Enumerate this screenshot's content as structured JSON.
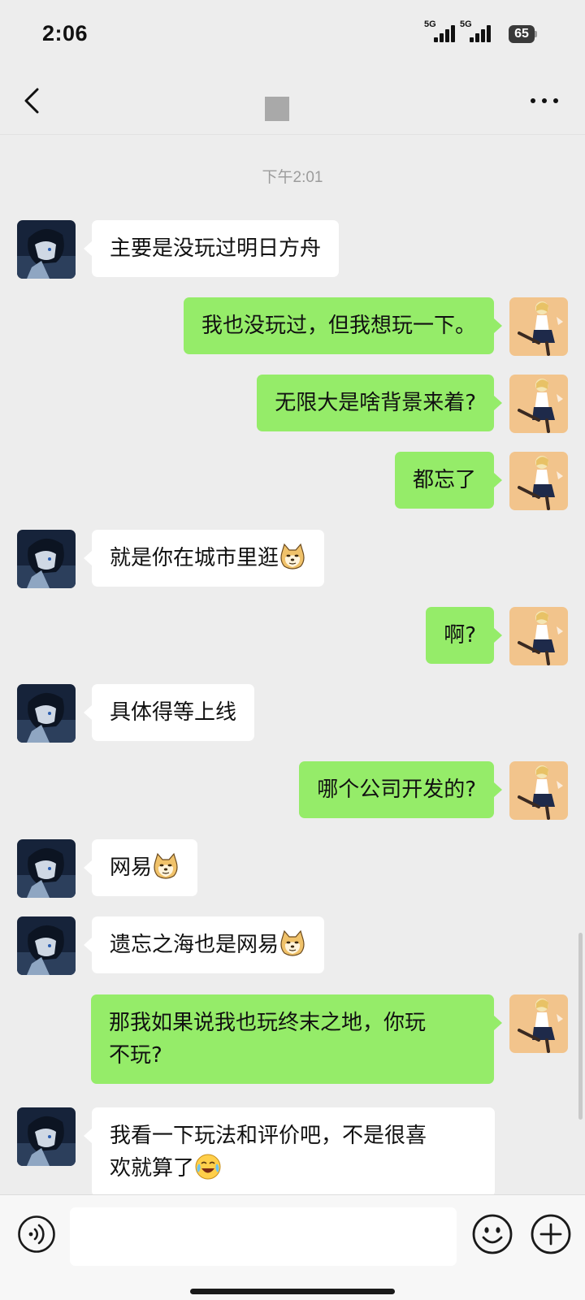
{
  "status_bar": {
    "time": "2:06",
    "sim1": "5G",
    "sim2": "5G",
    "battery": "65"
  },
  "header": {
    "back_icon": "chevron-left-icon",
    "more_icon": "ellipsis-icon"
  },
  "chat": {
    "timestamp": "下午2:01",
    "messages": [
      {
        "side": "left",
        "text": "主要是没玩过明日方舟",
        "emoji": null
      },
      {
        "side": "right",
        "text": "我也没玩过，但我想玩一下。",
        "emoji": null
      },
      {
        "side": "right",
        "text": "无限大是啥背景来着?",
        "emoji": null
      },
      {
        "side": "right",
        "text": "都忘了",
        "emoji": null
      },
      {
        "side": "left",
        "text": "就是你在城市里逛",
        "emoji": "doge"
      },
      {
        "side": "right",
        "text": "啊?",
        "emoji": null
      },
      {
        "side": "left",
        "text": "具体得等上线",
        "emoji": null
      },
      {
        "side": "right",
        "text": "哪个公司开发的?",
        "emoji": null
      },
      {
        "side": "left",
        "text": "网易",
        "emoji": "doge"
      },
      {
        "side": "left",
        "text": "遗忘之海也是网易",
        "emoji": "doge"
      },
      {
        "side": "right",
        "text": "那我如果说我也玩终末之地，你玩\n不玩?",
        "emoji": null
      },
      {
        "side": "left",
        "text": "我看一下玩法和评价吧，不是很喜\n欢就算了",
        "emoji": "laughing-crying"
      }
    ]
  },
  "input_bar": {
    "voice_icon": "voice-icon",
    "text_value": "",
    "emoji_icon": "smiley-icon",
    "plus_icon": "plus-icon"
  },
  "colors": {
    "background": "#ededed",
    "own_bubble": "#95ec69",
    "other_bubble": "#ffffff",
    "timestamp": "#9c9c9c"
  }
}
